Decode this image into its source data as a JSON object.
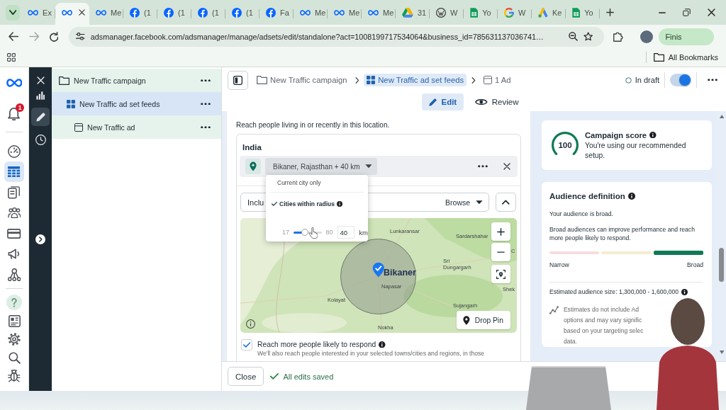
{
  "browser": {
    "tabs": [
      {
        "kind": "meta",
        "title": "Ex",
        "selected": false
      },
      {
        "kind": "meta",
        "selected": true
      },
      {
        "kind": "meta",
        "title": "Me",
        "selected": false
      },
      {
        "kind": "facebook",
        "title": "(1",
        "selected": false
      },
      {
        "kind": "facebook",
        "title": "(1",
        "selected": false
      },
      {
        "kind": "facebook",
        "title": "(1",
        "selected": false
      },
      {
        "kind": "facebook",
        "title": "(1",
        "selected": false
      },
      {
        "kind": "facebook",
        "title": "Fa",
        "selected": false
      },
      {
        "kind": "meta",
        "title": "Me",
        "selected": false
      },
      {
        "kind": "meta",
        "title": "Me",
        "selected": false
      },
      {
        "kind": "meta",
        "title": "Me",
        "selected": false
      },
      {
        "kind": "drive",
        "title": "31",
        "selected": false
      },
      {
        "kind": "wordpress",
        "title": "W",
        "selected": false
      },
      {
        "kind": "sheets",
        "title": "Yo",
        "selected": false
      },
      {
        "kind": "google",
        "title": "W",
        "selected": false
      },
      {
        "kind": "ads",
        "title": "Ke",
        "selected": false
      },
      {
        "kind": "sheets",
        "title": "Yo",
        "selected": false
      }
    ],
    "url": "adsmanager.facebook.com/adsmanager/manage/adsets/edit/standalone?act=1008199717534064&business_id=785631137036741…",
    "update_button": "Finis",
    "bookmarks_label": "All Bookmarks"
  },
  "nav_rail": {
    "groups": [
      {
        "items": [
          {
            "kind": "meta",
            "selected": false
          },
          {
            "kind": "bell",
            "badge": "1",
            "selected": false
          }
        ]
      },
      {
        "items": [
          {
            "kind": "gauge",
            "selected": false
          },
          {
            "kind": "table",
            "selected": true
          },
          {
            "kind": "pages",
            "selected": false
          },
          {
            "kind": "people",
            "selected": false
          },
          {
            "kind": "card",
            "selected": false
          },
          {
            "kind": "megaphone",
            "selected": false
          },
          {
            "kind": "network",
            "selected": false
          }
        ]
      },
      {
        "items": [
          {
            "kind": "help",
            "selected": false
          },
          {
            "kind": "news",
            "selected": false
          },
          {
            "kind": "gear",
            "selected": false
          },
          {
            "kind": "search",
            "selected": false
          },
          {
            "kind": "bug",
            "selected": false
          }
        ]
      }
    ]
  },
  "tool_rail": {
    "items": [
      {
        "kind": "close",
        "selected": false
      },
      {
        "kind": "chart",
        "selected": false
      },
      {
        "kind": "edit",
        "selected": true
      },
      {
        "kind": "history",
        "selected": false
      }
    ]
  },
  "tree": [
    {
      "kind": "campaign",
      "label": "New Traffic campaign",
      "selected": false,
      "children": [
        {
          "kind": "ad_set",
          "label": "New Traffic ad set feeds",
          "selected": true,
          "children": [
            {
              "kind": "ad",
              "label": "New Traffic ad",
              "selected": false
            }
          ]
        }
      ]
    }
  ],
  "header": {
    "breadcrumbs": [
      {
        "kind": "campaign",
        "label": "New Traffic campaign",
        "selected": false
      },
      {
        "kind": "ad_set",
        "label": "New Traffic ad set feeds",
        "selected": true
      },
      {
        "kind": "ad",
        "label": "1 Ad",
        "selected": false
      }
    ],
    "status": "In draft",
    "toggle": {
      "on": true
    }
  },
  "modes": [
    {
      "kind": "edit",
      "label": "Edit",
      "selected": true
    },
    {
      "kind": "review",
      "label": "Review",
      "selected": false
    }
  ],
  "location": {
    "intro": "Reach people living in or recently in this location.",
    "country": "India",
    "chip": "Bikaner, Rajasthan + 40 km",
    "menu": {
      "options": [
        {
          "label": "Current city only",
          "selected": false,
          "info": false
        },
        {
          "label": "Cities within radius",
          "selected": true,
          "info": true
        }
      ],
      "slider": {
        "min_label": "17",
        "max_label": "80",
        "value": "40",
        "unit": "km",
        "level": 0.37
      }
    },
    "include_field": "Inclu",
    "browse": "Browse",
    "map": {
      "places": [
        {
          "kind": "town",
          "name": "Lunkaransar"
        },
        {
          "kind": "town",
          "name": "Sardarshahar"
        },
        {
          "kind": "town",
          "name": "Sri Dungargarh"
        },
        {
          "kind": "city",
          "name": "Bikaner"
        },
        {
          "kind": "town",
          "name": "Napasar"
        },
        {
          "kind": "town",
          "name": "Kolayat"
        },
        {
          "kind": "town",
          "name": "Nokha"
        },
        {
          "kind": "town",
          "name": "Sujangarh"
        },
        {
          "kind": "town",
          "name": "Shek"
        },
        {
          "kind": "town",
          "name": "C"
        }
      ],
      "drop_pin": "Drop Pin"
    },
    "reach_more": {
      "checked": true,
      "label": "Reach more people likely to respond",
      "detail": "We'll also reach people interested in your selected towns/cities and regions, in those"
    }
  },
  "footer": {
    "close_button": "Close",
    "save_status": "All edits saved"
  },
  "score": {
    "value": "100",
    "level": 1,
    "title": "Campaign score",
    "text": "You're using our recommended setup."
  },
  "audience": {
    "title": "Audience definition",
    "summary": "Your audience is broad.",
    "detail": "Broad audiences can improve performance and reach more people likely to respond.",
    "segments": [
      {
        "color": "#f6dde0",
        "selected": false
      },
      {
        "color": "#f5edcf",
        "selected": false
      },
      {
        "color": "#0f7a55",
        "selected": true
      }
    ],
    "low_label": "Narrow",
    "high_label": "Broad",
    "estimate": "Estimated audience size: 1,300,000 - 1,600,000",
    "note_lines": [
      "Estimates do not include Ad",
      "options and may vary signific",
      "based on your targeting selec",
      "data."
    ]
  }
}
